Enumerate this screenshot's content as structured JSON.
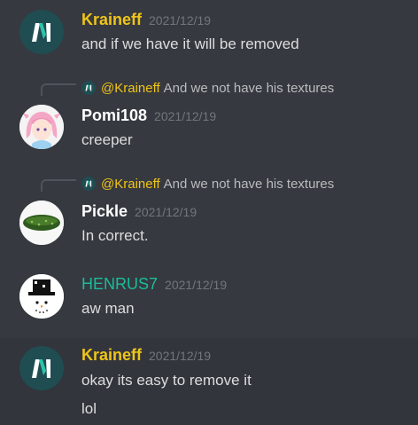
{
  "messages": [
    {
      "author": "Kraineff",
      "author_color": "#f0c419",
      "timestamp": "2021/12/19",
      "lines": [
        "and if we have it will be removed"
      ]
    },
    {
      "reply_to": {
        "mention": "@Kraineff",
        "text": "And we not have his textures"
      },
      "author": "Pomi108",
      "author_color": "#ffffff",
      "timestamp": "2021/12/19",
      "lines": [
        "creeper"
      ]
    },
    {
      "reply_to": {
        "mention": "@Kraineff",
        "text": "And we not have his textures"
      },
      "author": "Pickle",
      "author_color": "#ffffff",
      "timestamp": "2021/12/19",
      "lines": [
        "In correct."
      ]
    },
    {
      "author": "HENRUS7",
      "author_color": "#1abc9c",
      "timestamp": "2021/12/19",
      "lines": [
        "aw man"
      ]
    },
    {
      "author": "Kraineff",
      "author_color": "#f0c419",
      "timestamp": "2021/12/19",
      "lines": [
        "okay its easy to remove it",
        "lol"
      ]
    }
  ],
  "icons": {
    "kraineff_avatar": "m-logo-icon",
    "pomi_avatar": "anime-girl-avatar",
    "pickle_avatar": "pickle-avatar",
    "henrus_avatar": "snowman-top-hat-avatar"
  }
}
